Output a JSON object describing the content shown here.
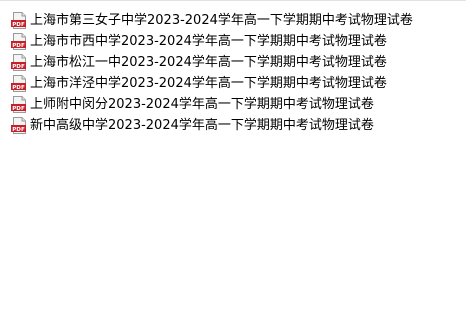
{
  "colors": {
    "background": "#ffffff",
    "text": "#000000",
    "pdf_badge": "#c8202a",
    "pdf_page": "#f4f4f4",
    "pdf_border": "#9a9a9a"
  },
  "icon": {
    "name": "pdf-file-icon",
    "badge_text": "PDF"
  },
  "files": [
    {
      "name": "上海市第三女子中学2023-2024学年高一下学期期中考试物理试卷"
    },
    {
      "name": "上海市市西中学2023-2024学年高一下学期期中考试物理试卷"
    },
    {
      "name": "上海市松江一中2023-2024学年高一下学期期中考试物理试卷"
    },
    {
      "name": "上海市洋泾中学2023-2024学年高一下学期期中考试物理试卷"
    },
    {
      "name": "上师附中闵分2023-2024学年高一下学期期中考试物理试卷"
    },
    {
      "name": "新中高级中学2023-2024学年高一下学期期中考试物理试卷"
    }
  ]
}
